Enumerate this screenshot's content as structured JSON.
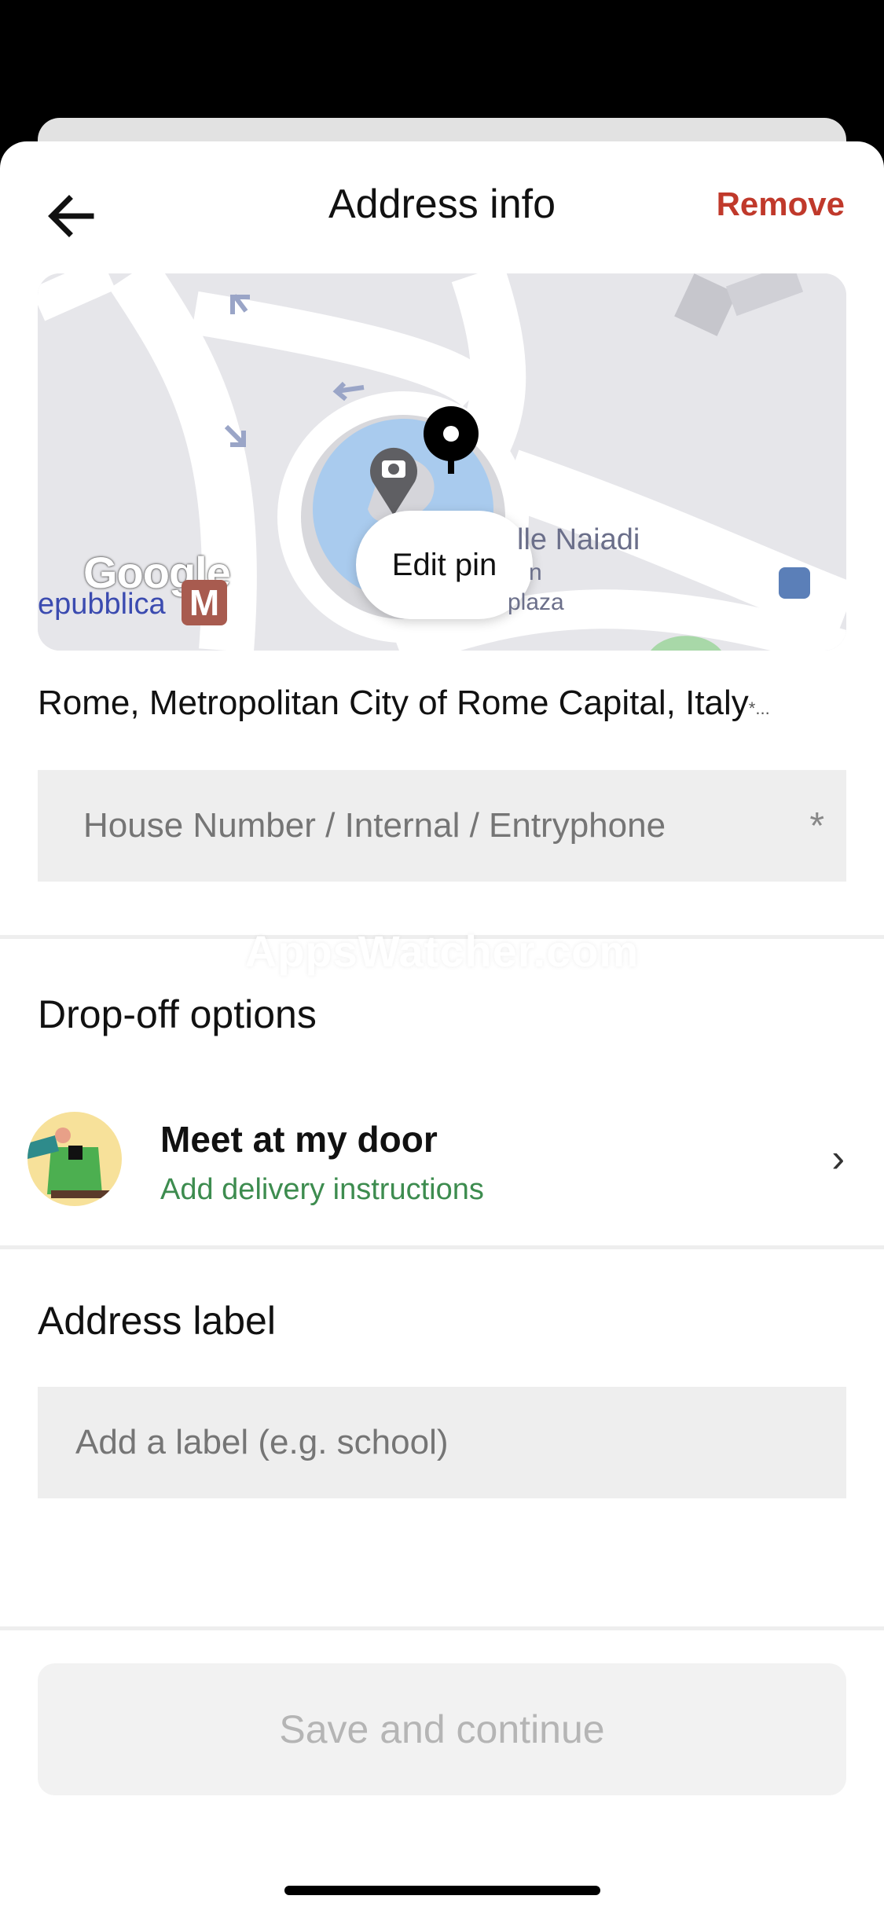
{
  "header": {
    "title": "Address info",
    "remove_label": "Remove"
  },
  "map": {
    "edit_pin_label": "Edit pin",
    "labels": {
      "street": "lle Naiadi",
      "street2": "n",
      "plaza": "plaza",
      "station": "epubblica",
      "metro": "M",
      "brand": "Google"
    }
  },
  "address": {
    "line": "Rome, Metropolitan City of Rome Capital, Italy",
    "required_mark": "*..."
  },
  "house_input": {
    "placeholder": "House Number / Internal / Entryphone",
    "required_mark": "*"
  },
  "watermark": "AppsWatcher.com",
  "dropoff": {
    "section_title": "Drop-off options",
    "option_title": "Meet at my door",
    "option_subtitle": "Add delivery instructions",
    "chevron": "›"
  },
  "address_label": {
    "section_title": "Address label",
    "placeholder": "Add a label (e.g. school)"
  },
  "footer": {
    "save_label": "Save and continue"
  },
  "colors": {
    "remove": "#c0392b",
    "subtitle_green": "#3d8c4f",
    "input_bg": "#eeeeee",
    "disabled_text": "#b5b5b5"
  }
}
